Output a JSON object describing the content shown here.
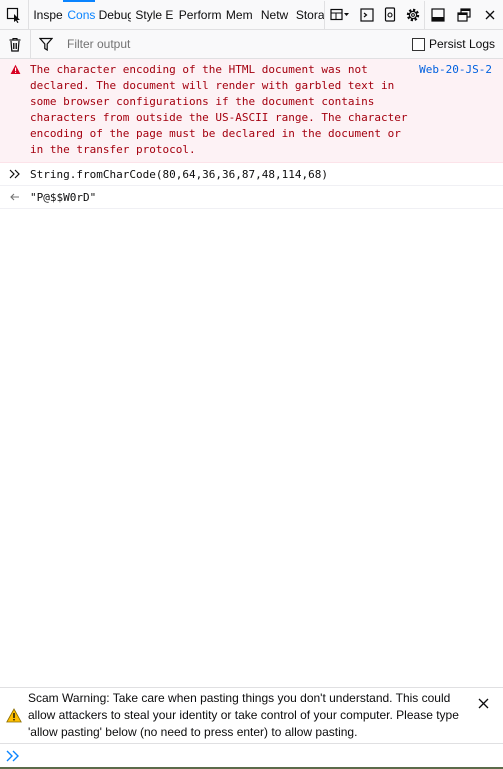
{
  "toolbar": {
    "tabs": [
      {
        "label": "Inspe",
        "selected": false
      },
      {
        "label": "Cons",
        "selected": true
      },
      {
        "label": "Debug",
        "selected": false
      },
      {
        "label": "Style E",
        "selected": false
      },
      {
        "label": "Perform",
        "selected": false
      },
      {
        "label": "Mem",
        "selected": false
      },
      {
        "label": "Netw",
        "selected": false
      },
      {
        "label": "Stora",
        "selected": false
      }
    ],
    "icons": [
      "element-picker-icon",
      "responsive-design-icon",
      "scratchpad-icon",
      "screenshot-icon",
      "settings-icon",
      "dock-icon",
      "undock-icon",
      "close-icon"
    ]
  },
  "filterbar": {
    "placeholder": "Filter output",
    "persist_label": "Persist Logs"
  },
  "output": {
    "error": {
      "text": "The character encoding of the HTML document was not declared. The document will render with garbled text in some browser configurations if the document contains characters from outside the US-ASCII range. The character encoding of the page must be declared in the document or in the transfer protocol.",
      "source": "Web-20-JS-2"
    },
    "command": "String.fromCharCode(80,64,36,36,87,48,114,68)",
    "result": "\"P@$$W0rD\""
  },
  "warning": {
    "text": "Scam Warning: Take care when pasting things you don't understand. This could allow attackers to steal your identity or take control of your computer. Please type 'allow pasting' below (no need to press enter) to allow pasting."
  },
  "colors": {
    "accent": "#0a84ff",
    "error_text": "#a4000f",
    "error_bg": "#fdf2f5",
    "source_link": "#0060df"
  }
}
